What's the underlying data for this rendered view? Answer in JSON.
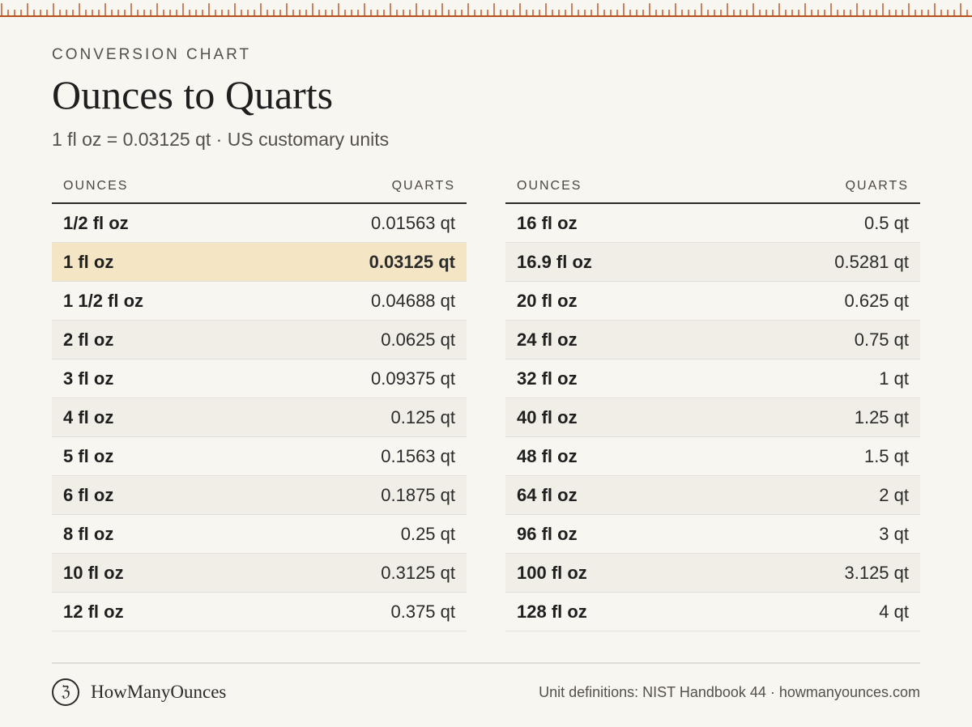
{
  "header": {
    "eyebrow": "CONVERSION CHART",
    "title": "Ounces to Quarts",
    "subtitle": "1 fl oz = 0.03125 qt · US customary units"
  },
  "table_headers": {
    "ounces": "OUNCES",
    "quarts": "QUARTS"
  },
  "left_rows": [
    {
      "oz": "1/2 fl oz",
      "qt": "0.01563 qt"
    },
    {
      "oz": "1 fl oz",
      "qt": "0.03125 qt",
      "highlighted": true
    },
    {
      "oz": "1 1/2 fl oz",
      "qt": "0.04688 qt"
    },
    {
      "oz": "2 fl oz",
      "qt": "0.0625 qt"
    },
    {
      "oz": "3 fl oz",
      "qt": "0.09375 qt"
    },
    {
      "oz": "4 fl oz",
      "qt": "0.125 qt"
    },
    {
      "oz": "5 fl oz",
      "qt": "0.1563 qt"
    },
    {
      "oz": "6 fl oz",
      "qt": "0.1875 qt"
    },
    {
      "oz": "8 fl oz",
      "qt": "0.25 qt"
    },
    {
      "oz": "10 fl oz",
      "qt": "0.3125 qt"
    },
    {
      "oz": "12 fl oz",
      "qt": "0.375 qt"
    }
  ],
  "right_rows": [
    {
      "oz": "16 fl oz",
      "qt": "0.5 qt"
    },
    {
      "oz": "16.9 fl oz",
      "qt": "0.5281 qt"
    },
    {
      "oz": "20 fl oz",
      "qt": "0.625 qt"
    },
    {
      "oz": "24 fl oz",
      "qt": "0.75 qt"
    },
    {
      "oz": "32 fl oz",
      "qt": "1 qt"
    },
    {
      "oz": "40 fl oz",
      "qt": "1.25 qt"
    },
    {
      "oz": "48 fl oz",
      "qt": "1.5 qt"
    },
    {
      "oz": "64 fl oz",
      "qt": "2 qt"
    },
    {
      "oz": "96 fl oz",
      "qt": "3 qt"
    },
    {
      "oz": "100 fl oz",
      "qt": "3.125 qt"
    },
    {
      "oz": "128 fl oz",
      "qt": "4 qt"
    }
  ],
  "footer": {
    "logo_glyph": "ℨ",
    "brand_name": "HowManyOunces",
    "source": "Unit definitions: NIST Handbook 44 · howmanyounces.com"
  },
  "colors": {
    "background": "#f8f6f1",
    "ruler": "#b5521f",
    "highlight_row": "#f4e6c5",
    "alt_row": "#f1eee7"
  }
}
